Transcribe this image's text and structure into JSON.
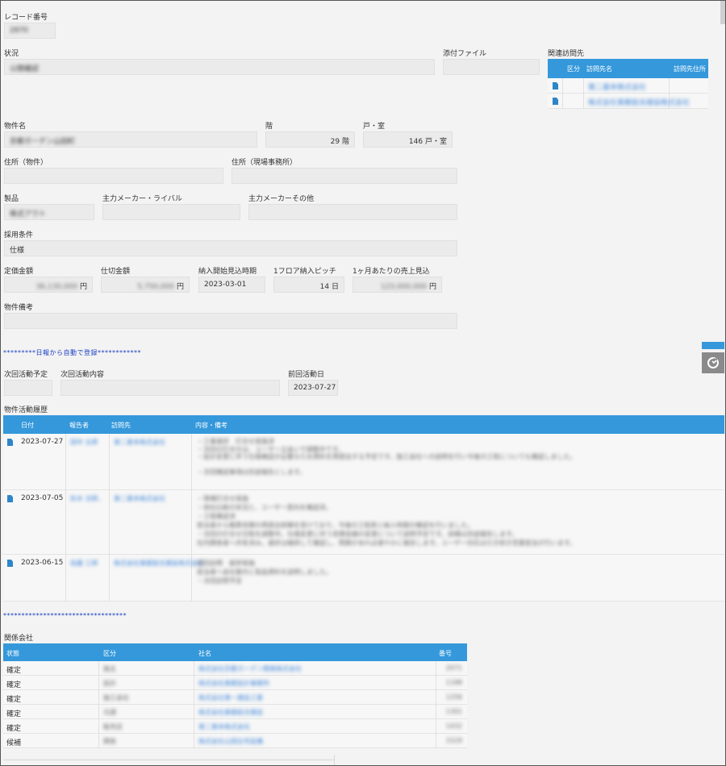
{
  "record": {
    "label": "レコード番号",
    "value": "2870"
  },
  "status": {
    "label": "状況",
    "value": "公開確認"
  },
  "attachment": {
    "label": "添付ファイル"
  },
  "related_visits": {
    "label": "関連訪問先",
    "headers": [
      "区分",
      "訪問先名",
      "訪問先住所"
    ],
    "rows": [
      {
        "name": "第二基本株式会社"
      },
      {
        "name": "株式会社東都総合建設株式会社"
      }
    ]
  },
  "property": {
    "label": "物件名",
    "value": "京都ガーデン山田町"
  },
  "floors": {
    "label": "階",
    "value": "29",
    "unit": "階"
  },
  "units": {
    "label": "戸・室",
    "value": "146",
    "unit": "戸・室"
  },
  "address_property": {
    "label": "住所（物件）"
  },
  "address_site": {
    "label": "住所（現場事務所）"
  },
  "product": {
    "label": "製品",
    "value": "株式アウト"
  },
  "maker_rival": {
    "label": "主力メーカー・ライバル"
  },
  "maker_other": {
    "label": "主力メーカーその他"
  },
  "adoption": {
    "label": "採用条件",
    "value": "仕様"
  },
  "list_price": {
    "label": "定価金額",
    "value": "36,130,000",
    "unit": "円"
  },
  "cost_price": {
    "label": "仕切金額",
    "value": "5,750,000",
    "unit": "円"
  },
  "delivery_start": {
    "label": "納入開始見込時期",
    "value": "2023-03-01"
  },
  "floor_pitch": {
    "label": "1フロア納入ピッチ",
    "value": "14",
    "unit": "日"
  },
  "monthly_sales": {
    "label": "1ヶ月あたりの売上見込",
    "value": "123,000,000",
    "unit": "円"
  },
  "property_notes": {
    "label": "物件備考"
  },
  "auto_register": {
    "text": "*********日報から自動で登録************"
  },
  "next_activity": {
    "label": "次回活動予定"
  },
  "next_activity_content": {
    "label": "次回活動内容"
  },
  "last_activity": {
    "label": "前回活動日",
    "value": "2023-07-27"
  },
  "history": {
    "label": "物件活動履歴",
    "headers": [
      "日付",
      "報告者",
      "訪問先",
      "内容・備考"
    ],
    "rows": [
      {
        "date": "2023-07-27",
        "reporter": "田中 太郎",
        "visit": "第二基本株式会社",
        "notes": [
          "・工事進捗　打合せ実施済",
          "・次回の打合せは、ユーザー立会いで調整中です。",
          "・設計変更に伴う仕様確認が必要なため資料を再提出する予定です。施工会社への説明を行い今後の工程についても確認しました。",
          "",
          "・次回確認事項は別途報告とします。"
        ]
      },
      {
        "date": "2023-07-05",
        "reporter": "鈴木 次郎、",
        "visit": "第二基本株式会社",
        "notes": [
          "・現場打合せ実施",
          "・他社比較の状況と、ユーザー意向を確認済。",
          "・工程確認済",
          "担当者から概算見積の再提出依頼を受けており、今後の工程表と納入時期の確認を行いました。",
          "・次回の打合せ日程を調整中。仕様変更に伴う見積金額の変更について説明予定です。詳細は別途報告します。",
          "社内関係者へ共有済み。進捗は継続して確認し、問題があれば速やかに報告します。ユーザー対応は引き続き営業担当が行います。"
        ]
      },
      {
        "date": "2023-06-15",
        "reporter": "佐藤 三郎",
        "visit": "株式会社東都総合建設株式会社",
        "notes": [
          "初回訪問　挨拶実施",
          "担当者へ会社案内と製品資料を説明しました。",
          "・次回訪問予定"
        ]
      }
    ]
  },
  "divider_stars": {
    "text": "**********************************"
  },
  "companies": {
    "label": "関係会社",
    "headers": [
      "状態",
      "区分",
      "社名",
      "番号"
    ],
    "rows": [
      {
        "status": "確定",
        "type": "施主",
        "name": "株式会社京都ガーデン開発株式会社",
        "no": "2071"
      },
      {
        "status": "確定",
        "type": "設計",
        "name": "株式会社東都設計事務所",
        "no": "1188"
      },
      {
        "status": "確定",
        "type": "施工会社",
        "name": "株式会社第一建設工業",
        "no": "1256"
      },
      {
        "status": "確定",
        "type": "元請",
        "name": "株式会社東都総合建設",
        "no": "1301"
      },
      {
        "status": "確定",
        "type": "販売店",
        "name": "第二基本株式会社",
        "no": "1432"
      },
      {
        "status": "候補",
        "type": "関係",
        "name": "株式会社山田住宅設備",
        "no": "1529"
      }
    ]
  }
}
